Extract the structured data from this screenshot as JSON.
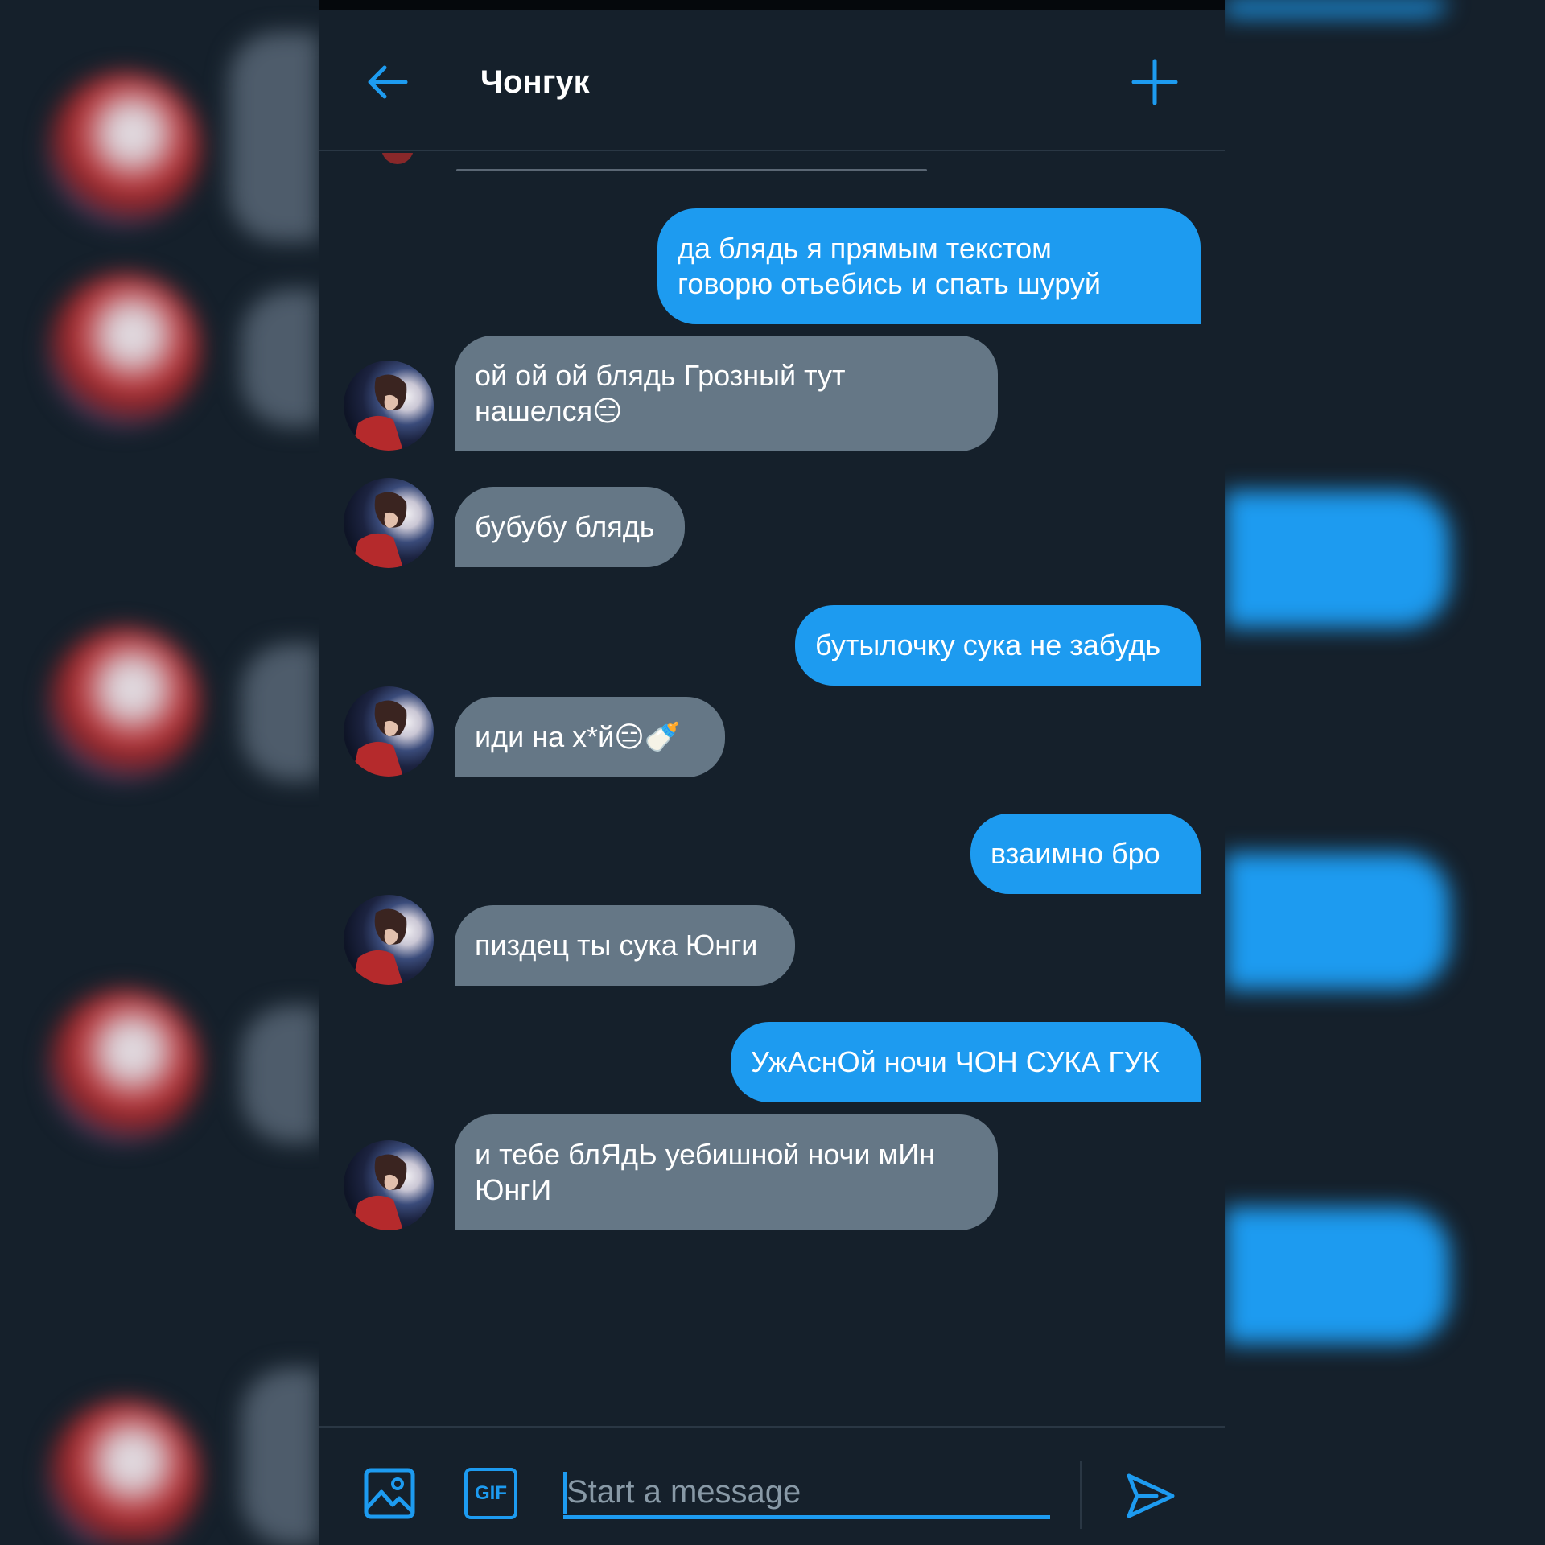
{
  "colors": {
    "accent": "#1d9bf0",
    "background": "#15202b",
    "incoming_bubble": "#657786",
    "outgoing_bubble": "#1d9bf0",
    "text": "#ffffff"
  },
  "header": {
    "title": "Чонгук",
    "back_icon": "arrow-left-icon",
    "new_icon": "plus-icon"
  },
  "messages": [
    {
      "direction": "out",
      "text": "да блядь я прямым текстом\nговорю отьебись и спать шуруй"
    },
    {
      "direction": "in",
      "text": "ой ой ой блядь Грозный тут\nнашелся😑"
    },
    {
      "direction": "in",
      "text": "бубубу блядь"
    },
    {
      "direction": "out",
      "text": "бутылочку сука не забудь"
    },
    {
      "direction": "in",
      "text": "иди на х*й😑🍼"
    },
    {
      "direction": "out",
      "text": "взаимно бро"
    },
    {
      "direction": "in",
      "text": "пиздец ты сука Юнги"
    },
    {
      "direction": "out",
      "text": "УжАснОй ночи ЧОН СУКА ГУК"
    },
    {
      "direction": "in",
      "text": "и тебе блЯдЬ уебишной ночи мИн\nЮнгИ"
    }
  ],
  "composer": {
    "image_icon": "image-icon",
    "gif_label": "GIF",
    "placeholder": "Start a message",
    "send_icon": "send-icon"
  }
}
